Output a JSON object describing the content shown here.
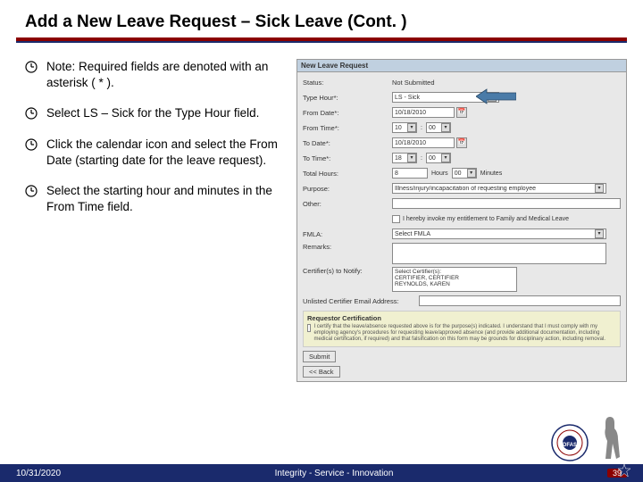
{
  "title": "Add a New Leave Request – Sick Leave (Cont. )",
  "bullets": [
    "Note:  Required fields are denoted with an asterisk ( * ).",
    "Select LS – Sick for the Type Hour field.",
    "Click the calendar icon and select the From Date (starting date for the leave request).",
    "Select the starting hour and minutes in the From Time field."
  ],
  "panel": {
    "header": "New Leave Request",
    "labels": {
      "status": "Status:",
      "statusVal": "Not Submitted",
      "typeHour": "Type Hour*:",
      "typeHourVal": "LS - Sick",
      "fromDate": "From Date*:",
      "fromDateVal": "10/18/2010",
      "fromTime": "From Time*:",
      "fromTimeH": "10",
      "fromTimeM": "00",
      "toDate": "To Date*:",
      "toDateVal": "10/18/2010",
      "toTime": "To Time*:",
      "toTimeH": "18",
      "toTimeM": "00",
      "totalHours": "Total Hours:",
      "totalHoursVal": "8",
      "hoursText": "Hours",
      "minutesVal": "00",
      "minutesText": "Minutes",
      "purpose": "Purpose:",
      "purposeVal": "Illness/injury/incapacitation of requesting employee",
      "other": "Other:",
      "absenceCheck": "I hereby invoke my entitlement to Family and Medical Leave",
      "fmla": "FMLA:",
      "fmlaVal": "Select FMLA",
      "remarks": "Remarks:",
      "certifier": "Certifier(s) to Notify:",
      "certSelHeader": "Select Certifier(s):",
      "cert1": "CERTIFIER, CERTIFIER",
      "cert2": "REYNOLDS, KAREN",
      "unlisted": "Unlisted Certifier Email Address:"
    },
    "cert": {
      "title": "Requestor Certification",
      "body": "I certify that the leave/absence requested above is for the purpose(s) indicated. I understand that I must comply with my employing agency's procedures for requesting leave/approved absence (and provide additional documentation, including medical certification, if required) and that falsification on this form may be grounds for disciplinary action, including removal."
    },
    "submit": "Submit",
    "back": "<< Back"
  },
  "footer": {
    "date": "10/31/2020",
    "motto": "Integrity - Service - Innovation",
    "page": "39"
  }
}
